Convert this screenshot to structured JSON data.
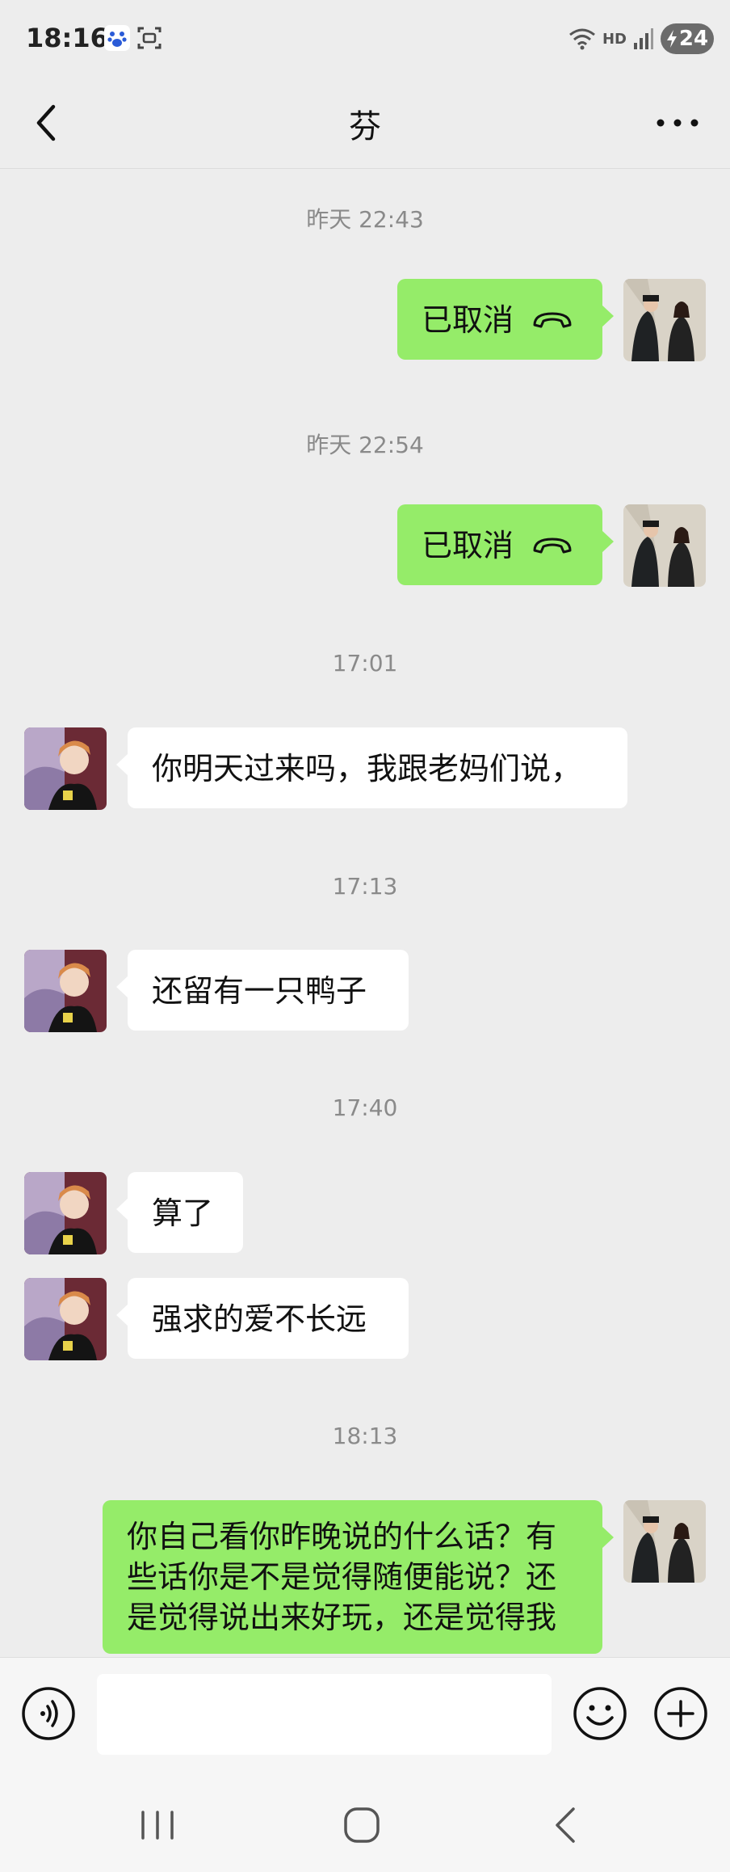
{
  "status_bar": {
    "time": "18:16",
    "network": "HD",
    "battery": "24",
    "icons": [
      "baidu-app-icon",
      "screenshot-icon",
      "wifi-icon",
      "signal-icon",
      "battery-charging-icon"
    ]
  },
  "header": {
    "title": "芬",
    "back_icon": "chevron-left-icon",
    "more_icon": "more-dots-icon"
  },
  "messages": [
    {
      "type": "timestamp",
      "text": "昨天 22:43"
    },
    {
      "type": "call",
      "direction": "out",
      "text": "已取消",
      "icon": "phone-hangup-icon"
    },
    {
      "type": "timestamp",
      "text": "昨天 22:54"
    },
    {
      "type": "call",
      "direction": "out",
      "text": "已取消",
      "icon": "phone-hangup-icon"
    },
    {
      "type": "timestamp",
      "text": "17:01"
    },
    {
      "type": "text",
      "direction": "in",
      "text": "你明天过来吗，我跟老妈们说，"
    },
    {
      "type": "timestamp",
      "text": "17:13"
    },
    {
      "type": "text",
      "direction": "in",
      "text": "还留有一只鸭子"
    },
    {
      "type": "timestamp",
      "text": "17:40"
    },
    {
      "type": "text",
      "direction": "in",
      "text": "算了"
    },
    {
      "type": "text",
      "direction": "in",
      "text": "强求的爱不长远"
    },
    {
      "type": "timestamp",
      "text": "18:13"
    },
    {
      "type": "text",
      "direction": "out",
      "text": "你自己看你昨晚说的什么话？有些话你是不是觉得随便能说？还是觉得说出来好玩，还是觉得我"
    }
  ],
  "input_bar": {
    "voice_icon": "voice-input-icon",
    "emoji_icon": "emoji-icon",
    "plus_icon": "plus-circle-icon",
    "placeholder": ""
  },
  "system_nav": {
    "icons": [
      "recent-apps-icon",
      "home-icon",
      "back-icon"
    ]
  },
  "colors": {
    "background": "#ededed",
    "outgoing_bubble": "#95ec69",
    "incoming_bubble": "#ffffff",
    "timestamp": "#8a8a8a"
  }
}
